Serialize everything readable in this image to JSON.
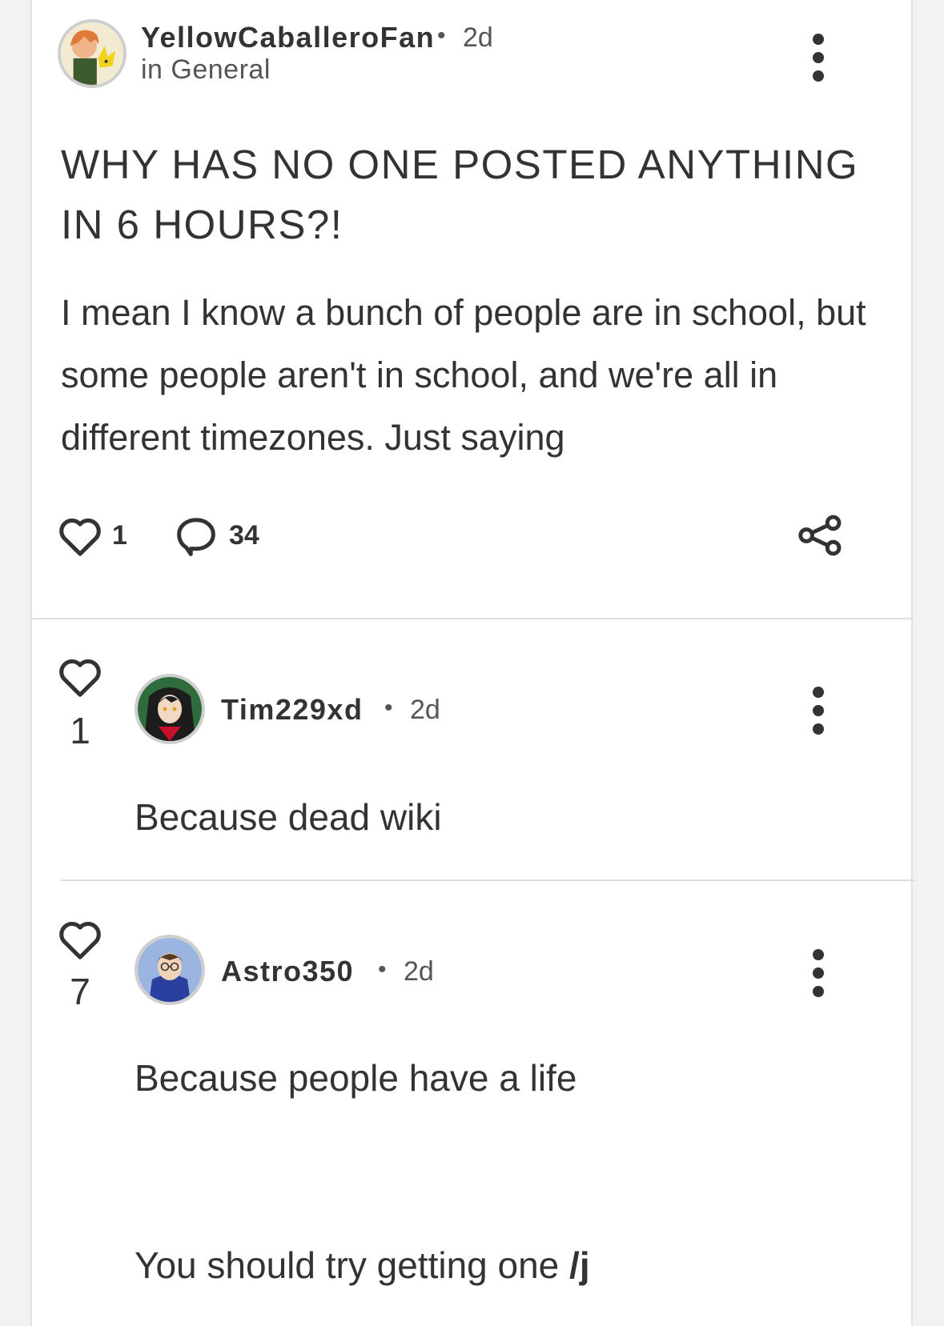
{
  "post": {
    "author": "YellowCaballeroFan",
    "separator": "•",
    "time": "2d",
    "category": "in General",
    "title": "WHY HAS NO ONE POSTED ANYTHING IN 6 HOURS?!",
    "body": "I mean I know a bunch of people are in school, but some people aren't in school, and we're all in different timezones. Just saying",
    "likes": "1",
    "comments": "34"
  },
  "replies": [
    {
      "author": "Tim229xd",
      "separator": "•",
      "time": "2d",
      "likes": "1",
      "text": "Because dead wiki"
    },
    {
      "author": "Astro350",
      "separator": "•",
      "time": "2d",
      "likes": "7",
      "text_line1": "Because people have a life",
      "text_line2": "You should try getting one",
      "text_tag": "/j"
    }
  ],
  "icons": {
    "like": "heart-icon",
    "comment": "speech-bubble-icon",
    "share": "share-icon",
    "menu": "vertical-ellipsis-icon"
  }
}
